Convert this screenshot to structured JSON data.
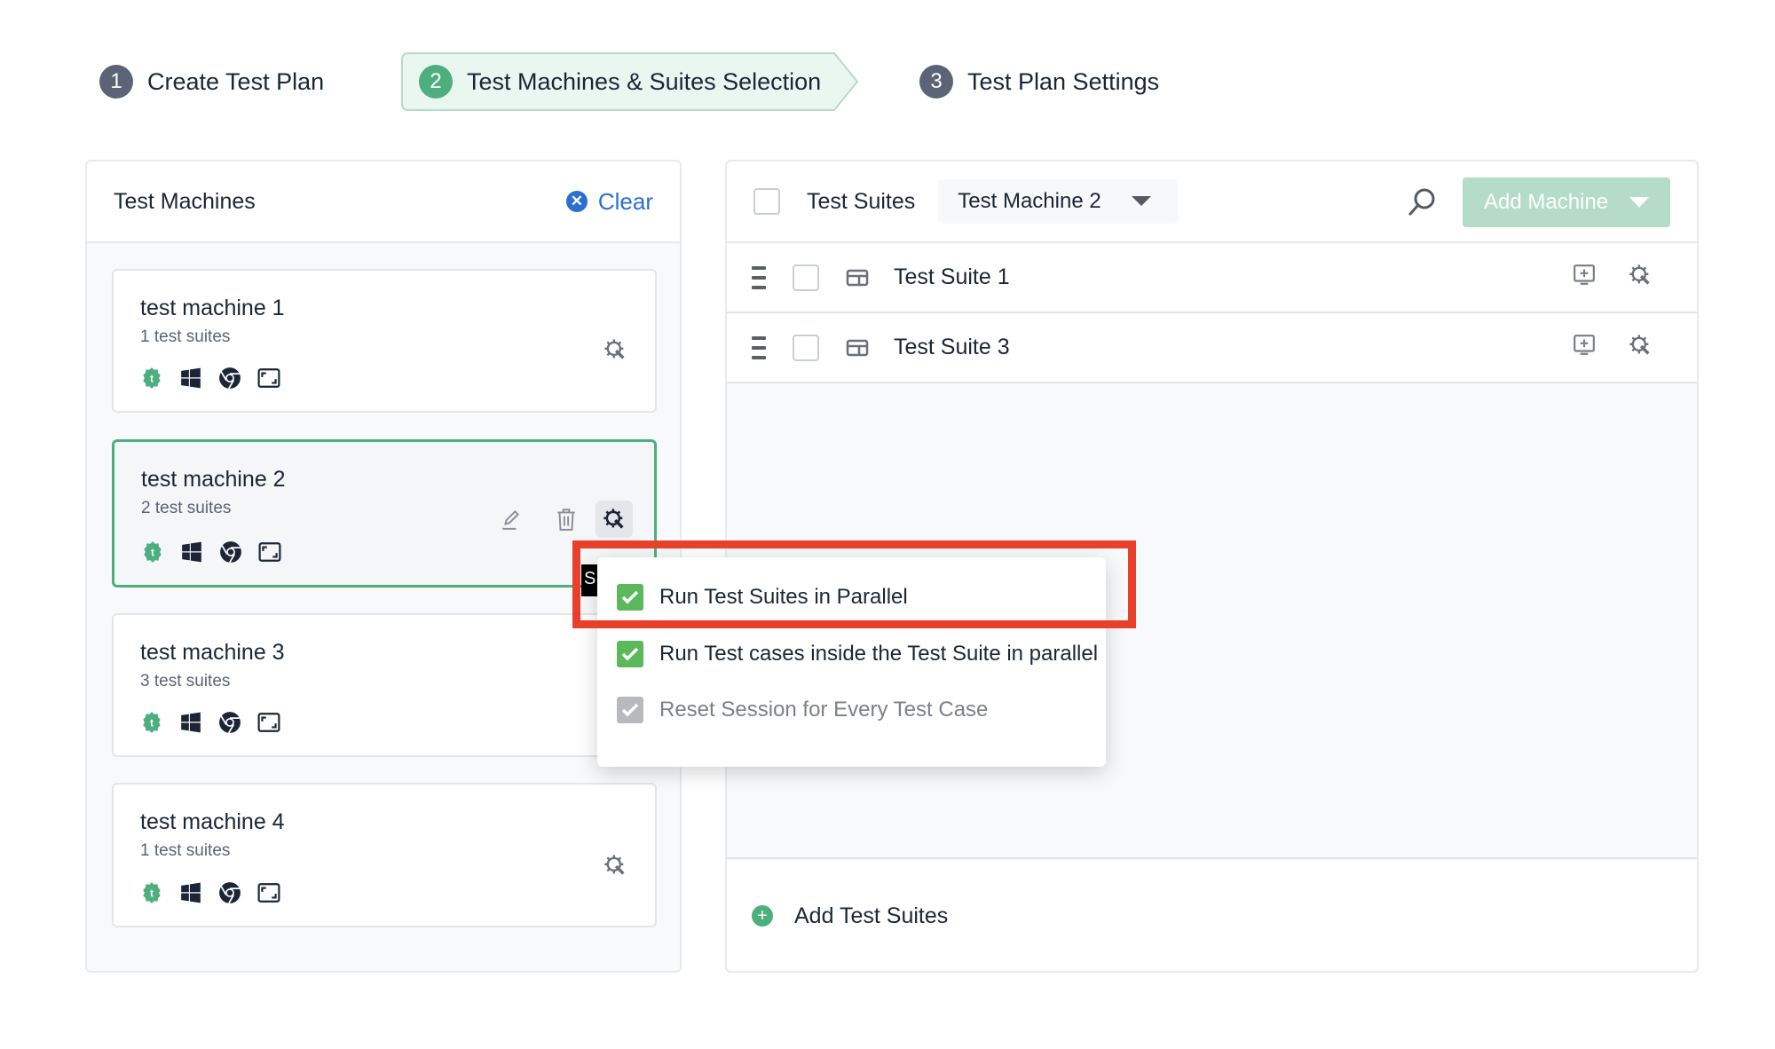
{
  "stepper": [
    {
      "number": "1",
      "label": "Create Test Plan",
      "state": "inactive"
    },
    {
      "number": "2",
      "label": "Test Machines & Suites Selection",
      "state": "active"
    },
    {
      "number": "3",
      "label": "Test Plan Settings",
      "state": "inactive"
    }
  ],
  "machines_panel": {
    "title": "Test Machines",
    "clear_label": "Clear",
    "machines": [
      {
        "name": "test machine 1",
        "suites": "1 test suites",
        "selected": false
      },
      {
        "name": "test machine 2",
        "suites": "2 test suites",
        "selected": true
      },
      {
        "name": "test machine 3",
        "suites": "3 test suites",
        "selected": false
      },
      {
        "name": "test machine 4",
        "suites": "1 test suites",
        "selected": false
      }
    ],
    "os_icons": [
      "testsigma-agent-icon",
      "windows-icon",
      "chrome-icon",
      "resolution-icon"
    ]
  },
  "suites_panel": {
    "title": "Test Suites",
    "machine_select_value": "Test Machine 2",
    "add_machine_label": "Add Machine",
    "suites": [
      {
        "name": "Test Suite 1"
      },
      {
        "name": "Test Suite 3"
      }
    ],
    "add_suites_label": "Add Test Suites"
  },
  "settings_popup": {
    "tooltip_fragment": "S",
    "options": [
      {
        "label": "Run Test Suites in Parallel",
        "checked": true,
        "disabled": false,
        "highlighted": true
      },
      {
        "label": "Run Test cases inside the Test Suite in parallel",
        "checked": true,
        "disabled": false
      },
      {
        "label": "Reset Session for Every Test Case",
        "checked": true,
        "disabled": true
      }
    ]
  },
  "colors": {
    "accent_green": "#4caf7d",
    "link_blue": "#2b6fd1",
    "highlight_red": "#e8402a",
    "checkbox_green": "#5cb85c",
    "add_machine_disabled": "#b4dcc8"
  }
}
